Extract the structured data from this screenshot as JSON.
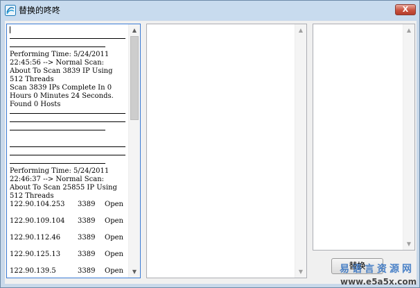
{
  "window": {
    "title": "替换的咚咚",
    "close_glyph": "X"
  },
  "log": {
    "run1": {
      "line1": "Performing Time: 5/24/2011",
      "line2": "22:45:56 --> Normal Scan:",
      "line3": "About To Scan 3839 IP Using",
      "line4": "512 Threads",
      "line5": "Scan 3839 IPs Complete In 0",
      "line6": "Hours 0 Minutes 24 Seconds.",
      "line7": "Found 0 Hosts"
    },
    "run2": {
      "line1": "Performing Time: 5/24/2011",
      "line2": "22:46:37 --> Normal Scan:",
      "line3": "About To Scan 25855 IP Using",
      "line4": "512 Threads"
    },
    "results": [
      {
        "ip": "122.90.104.253",
        "port": "3389",
        "state": "Open"
      },
      {
        "ip": "122.90.109.104",
        "port": "3389",
        "state": "Open"
      },
      {
        "ip": "122.90.112.46",
        "port": "3389",
        "state": "Open"
      },
      {
        "ip": "122.90.125.13",
        "port": "3389",
        "state": "Open"
      },
      {
        "ip": "122.90.139.5",
        "port": "3389",
        "state": "Open"
      }
    ]
  },
  "buttons": {
    "replace_label": "替换"
  },
  "watermark": {
    "brand": "易语言资源网",
    "domain": "www.e5a5x.com"
  },
  "icons": {
    "app": "app-logo-icon",
    "scroll_up": "scroll-up-arrow-icon",
    "scroll_down": "scroll-down-arrow-icon"
  },
  "colors": {
    "titlebar": "#c8dbee",
    "focus_border": "#3a7bd5",
    "close_button": "#c9523f",
    "watermark_blue": "#2f6fc0"
  }
}
